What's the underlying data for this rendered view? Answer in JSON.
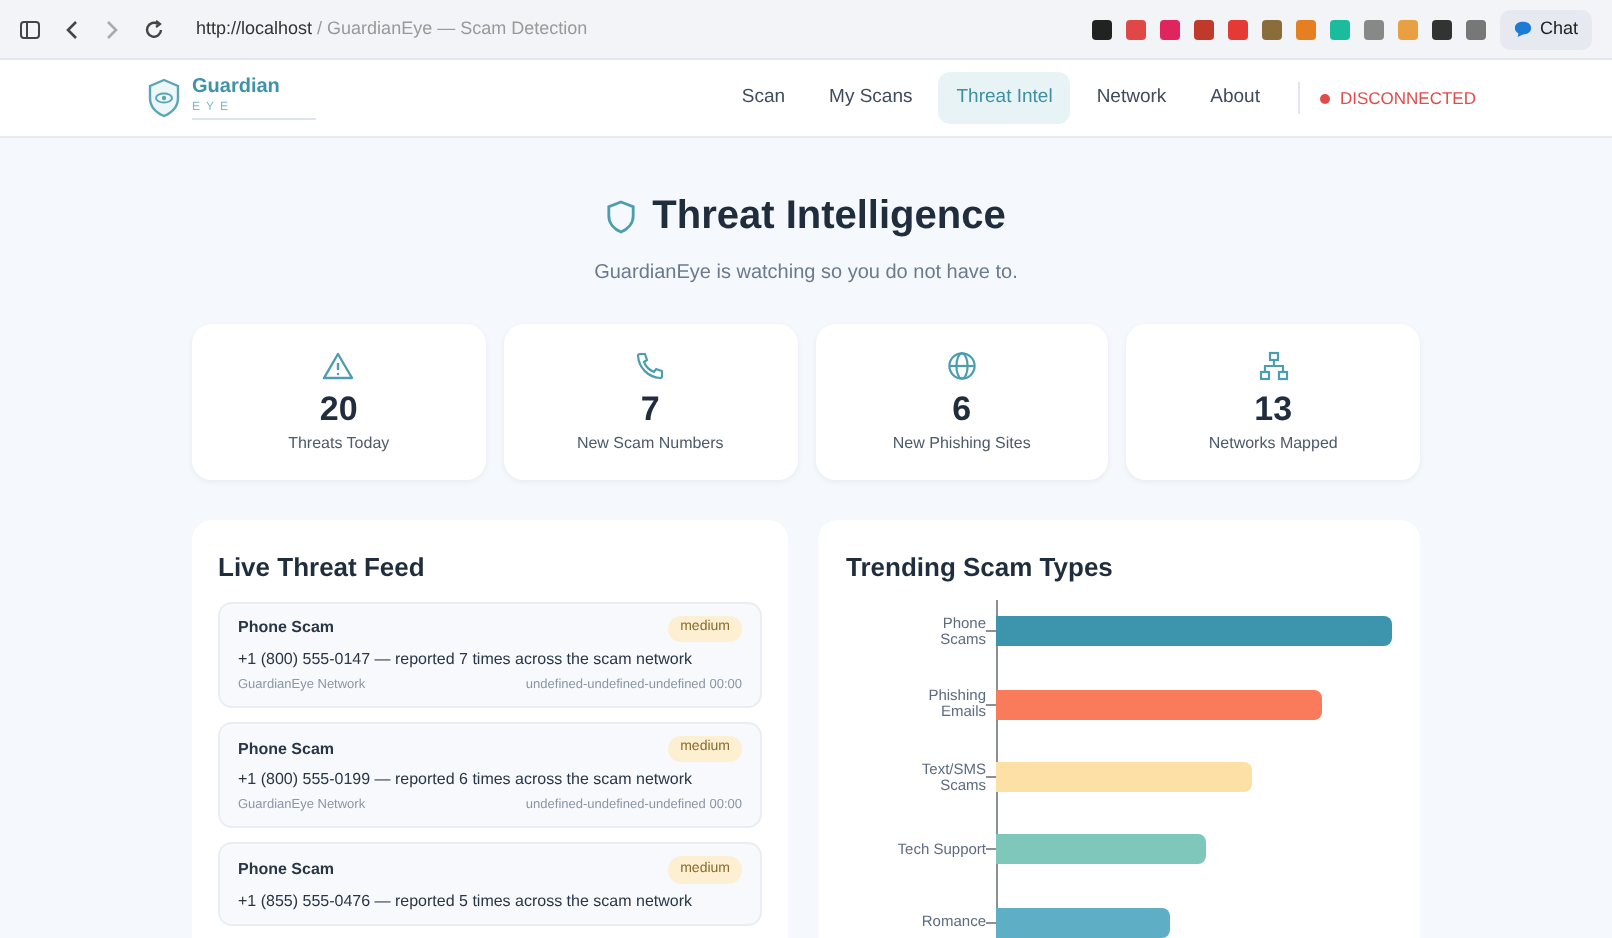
{
  "browser": {
    "url_host": "http://localhost",
    "url_rest": " / GuardianEye — Scam Detection",
    "chat_button": "Chat"
  },
  "brand": {
    "name": "Guardian",
    "tagline": "EYE"
  },
  "nav": [
    {
      "label": "Scan",
      "selected": false
    },
    {
      "label": "My Scans",
      "selected": false
    },
    {
      "label": "Threat Intel",
      "selected": true
    },
    {
      "label": "Network",
      "selected": false
    },
    {
      "label": "About",
      "selected": false
    }
  ],
  "connection": {
    "label": "DISCONNECTED",
    "connected": false
  },
  "header": {
    "title": "Threat Intelligence",
    "subtitle": "GuardianEye is watching so you do not have to."
  },
  "stats": [
    {
      "kind": "warning",
      "value": "20",
      "label": "Threats Today"
    },
    {
      "kind": "phone",
      "value": "7",
      "label": "New Scam Numbers"
    },
    {
      "kind": "globe",
      "value": "6",
      "label": "New Phishing Sites"
    },
    {
      "kind": "network",
      "value": "13",
      "label": "Networks Mapped"
    }
  ],
  "feed": {
    "title": "Live Threat Feed",
    "items": [
      {
        "type": "Phone Scam",
        "severity": "medium",
        "text": "+1 (800) 555-0147 — reported 7 times across the scam network",
        "source": "GuardianEye Network",
        "time": "undefined-undefined-undefined 00:00"
      },
      {
        "type": "Phone Scam",
        "severity": "medium",
        "text": "+1 (800) 555-0199 — reported 6 times across the scam network",
        "source": "GuardianEye Network",
        "time": "undefined-undefined-undefined 00:00"
      },
      {
        "type": "Phone Scam",
        "severity": "medium",
        "text": "+1 (855) 555-0476 — reported 5 times across the scam network"
      }
    ]
  },
  "trending": {
    "title": "Trending Scam Types",
    "bars": [
      {
        "label": "Phone Scams",
        "color": "#3d94ad"
      },
      {
        "label": "Phishing Emails",
        "color": "#fa7b5c"
      },
      {
        "label": "Text/SMS Scams",
        "color": "#fde0a6"
      },
      {
        "label": "Tech Support",
        "color": "#7fc6bb"
      },
      {
        "label": "Romance",
        "color": "#5eaec6"
      }
    ]
  }
}
